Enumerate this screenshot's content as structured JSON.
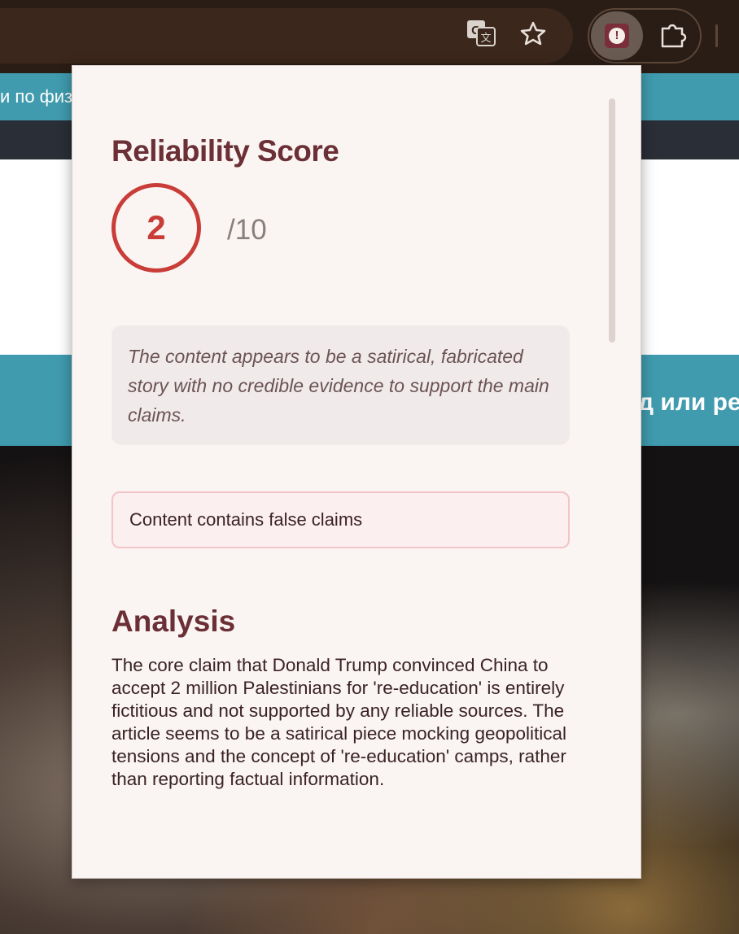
{
  "browser": {
    "translate_icon": "translate-icon",
    "bookmark_icon": "star-icon",
    "extension_icon": "alert-extension-icon",
    "extensions_menu_icon": "puzzle-icon"
  },
  "background_page": {
    "top_band_text": "и по физ",
    "teal_band_text": "д или ре"
  },
  "popup": {
    "score_title": "Reliability Score",
    "score_value": "2",
    "score_max": "/10",
    "summary": "The content appears to be a satirical, fabricated story with no credible evidence to support the main claims.",
    "alert": "Content contains false claims",
    "analysis_title": "Analysis",
    "analysis_body": "The core claim that Donald Trump convinced China to accept 2 million Palestinians for 're-education' is entirely fictitious and not supported by any reliable sources. The article seems to be a satirical piece mocking geopolitical tensions and the concept of 're-education' camps, rather than reporting factual information."
  },
  "colors": {
    "accent": "#6b2f36",
    "score_ring": "#c93d38",
    "page_teal": "#3f9bad"
  }
}
